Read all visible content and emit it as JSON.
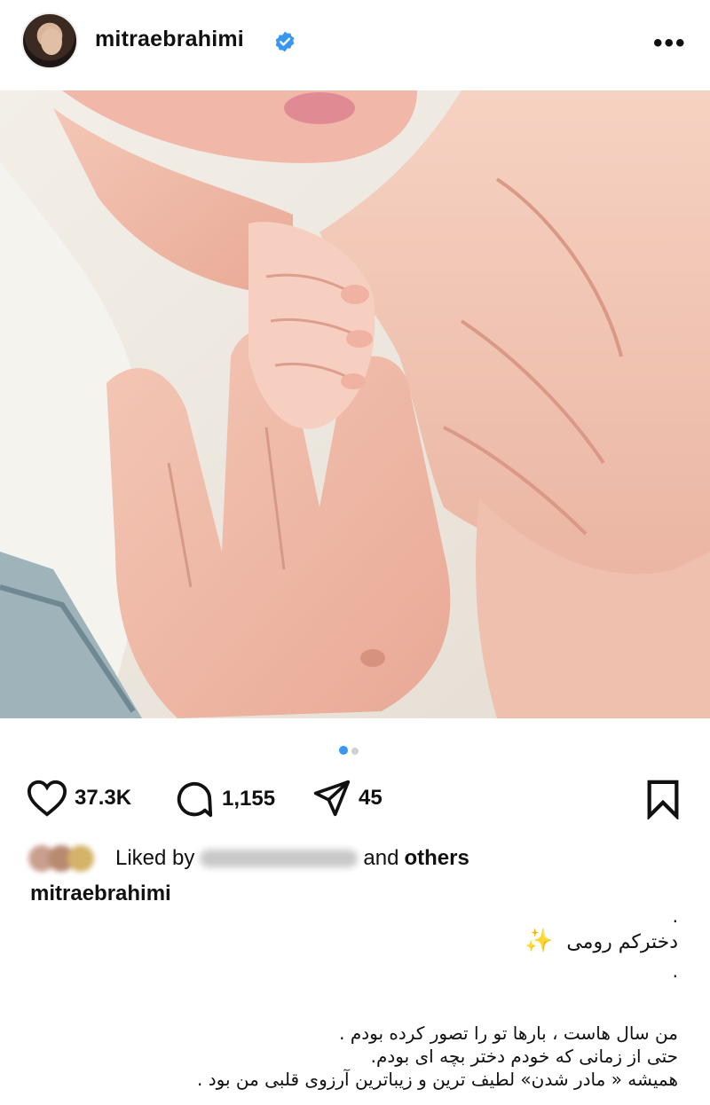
{
  "header": {
    "username": "mitraebrahimi",
    "verified_icon": "verified-badge-icon",
    "more_icon": "more-options-icon",
    "more_label": "•••"
  },
  "post": {
    "carousel": {
      "current": 1,
      "total": 2
    },
    "actions": {
      "likes": "37.3K",
      "comments": "1,155",
      "shares": "45"
    },
    "liked_by": {
      "prefix": "Liked by",
      "suffix_and": "and",
      "suffix_others": "others"
    },
    "caption": {
      "username": "mitraebrahimi",
      "dot1": ".",
      "title": "دخترکم رومی",
      "dot2": ".",
      "line1": "من سال هاست ، بارها تو را تصور کرده بودم .",
      "line2": "حتی از زمانی که خودم دختر بچه ای بودم.",
      "line3": "همیشه « مادر شدن» لطیف ترین و زیباترین آرزوی قلبی من بود ."
    }
  },
  "colors": {
    "accent": "#3897f0",
    "text": "#111111",
    "verified": "#3897f0"
  }
}
